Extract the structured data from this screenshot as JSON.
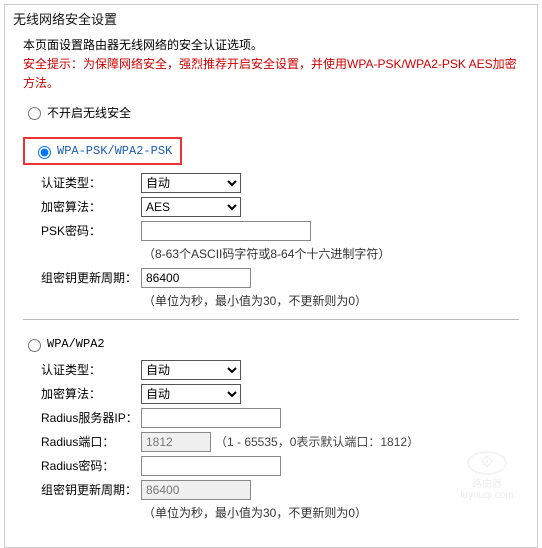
{
  "title": "无线网络安全设置",
  "intro": {
    "line1": "本页面设置路由器无线网络的安全认证选项。",
    "tip_label": "安全提示：",
    "tip_text": "为保障网络安全，强烈推荐开启安全设置，并使用WPA-PSK/WPA2-PSK AES加密方法。"
  },
  "option_disable": "不开启无线安全",
  "psk": {
    "label": "WPA-PSK/WPA2-PSK",
    "auth_label": "认证类型：",
    "auth_value": "自动",
    "algo_label": "加密算法：",
    "algo_value": "AES",
    "pwd_label": "PSK密码：",
    "pwd_value": "",
    "pwd_hint": "（8-63个ASCII码字符或8-64个十六进制字符）",
    "gk_label": "组密钥更新周期：",
    "gk_value": "86400",
    "gk_hint": "（单位为秒，最小值为30，不更新则为0）"
  },
  "wpa": {
    "label": "WPA/WPA2",
    "auth_label": "认证类型：",
    "auth_value": "自动",
    "algo_label": "加密算法：",
    "algo_value": "自动",
    "radius_ip_label": "Radius服务器IP：",
    "radius_ip_value": "",
    "radius_port_label": "Radius端口：",
    "radius_port_value": "1812",
    "radius_port_hint": "（1 - 65535，0表示默认端口：1812）",
    "radius_pwd_label": "Radius密码：",
    "radius_pwd_value": "",
    "gk_label": "组密钥更新周期：",
    "gk_value": "86400",
    "gk_hint": "（单位为秒，最小值为30，不更新则为0）"
  },
  "watermark": {
    "brand": "路由器",
    "url": "luyouqi.com"
  }
}
